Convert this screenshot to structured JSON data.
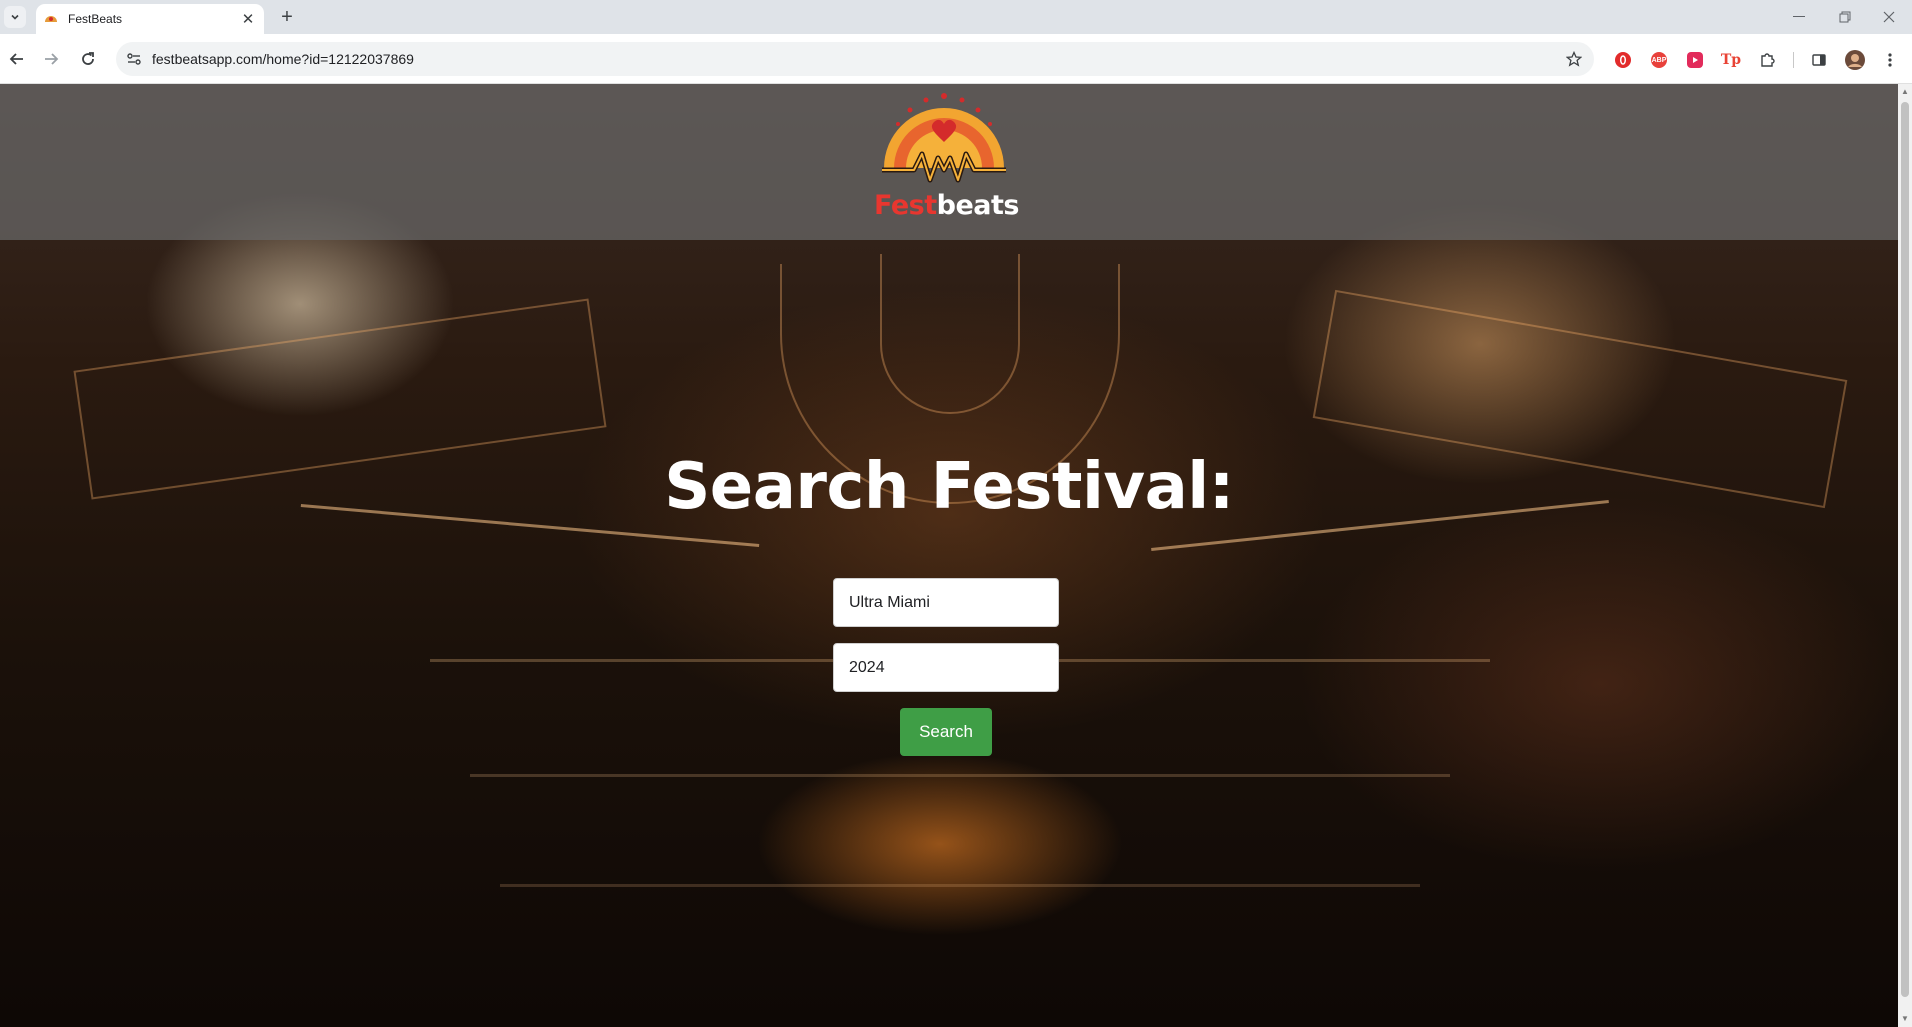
{
  "browser": {
    "tab_title": "FestBeats",
    "url": "festbeatsapp.com/home?id=12122037869",
    "extensions": [
      {
        "name": "opera-extension-icon",
        "color": "#e22b2b",
        "label": ""
      },
      {
        "name": "adblock-plus-icon",
        "color": "#e8413b",
        "label": "ABP"
      },
      {
        "name": "video-extension-icon",
        "color": "#e22b5b",
        "label": ""
      },
      {
        "name": "tp-extension-icon",
        "color": "#e84335",
        "label": "Tp"
      }
    ]
  },
  "site": {
    "logo_fest": "Fest",
    "logo_beats": "beats",
    "brand_red": "#e8362f",
    "accent_green": "#3f9e46"
  },
  "search": {
    "title": "Search Festival:",
    "festival_value": "Ultra Miami",
    "year_value": "2024",
    "button_label": "Search"
  }
}
